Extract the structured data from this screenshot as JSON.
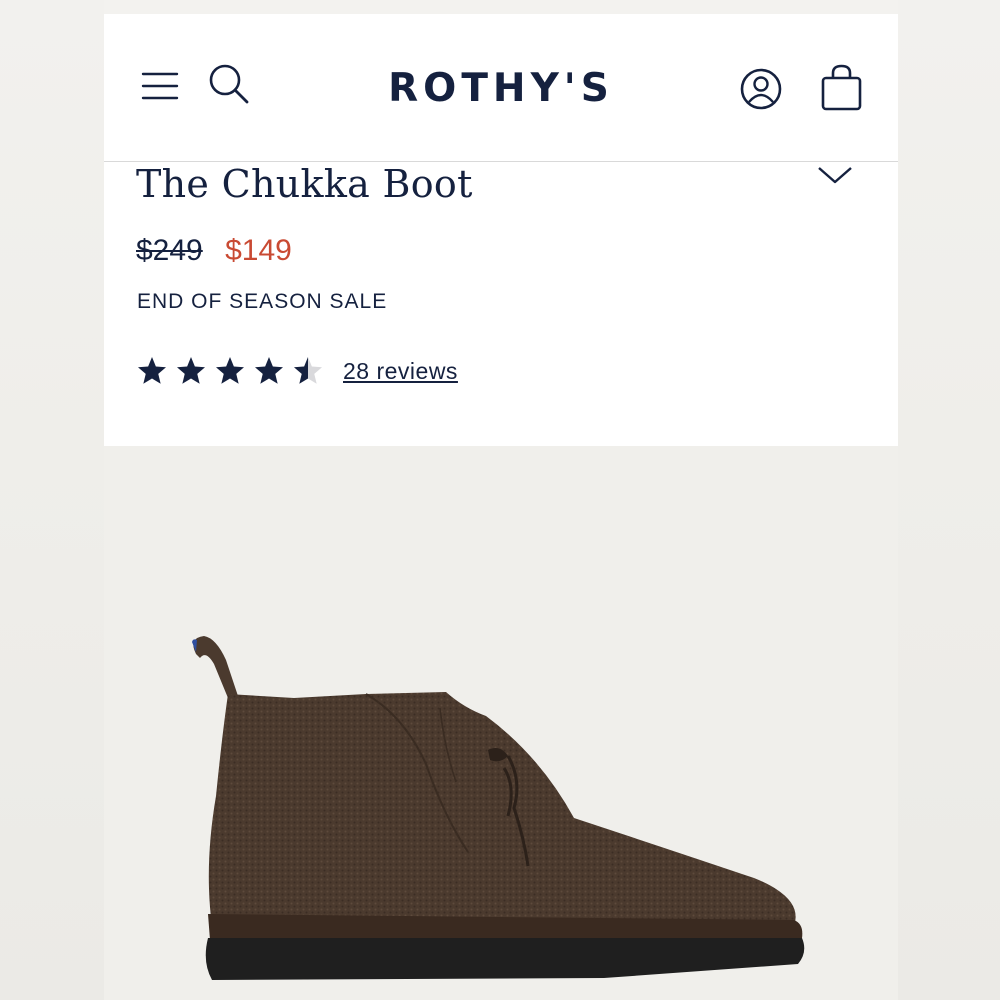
{
  "header": {
    "brand": "ROTHY'S",
    "icons": [
      "menu-icon",
      "search-icon",
      "account-icon",
      "shopping-bag-icon"
    ]
  },
  "product": {
    "title": "The Chukka Boot",
    "original_price": "$249",
    "sale_price": "$149",
    "promo_label": "END OF SEASON SALE",
    "rating": 4.5,
    "rating_max": 5,
    "reviews_label": "28 reviews",
    "image": "brown-knit-chukka-boot"
  },
  "colors": {
    "navy": "#15213f",
    "sale_red": "#c94a33",
    "background": "#f0efeb",
    "boot_brown": "#4b3a2e",
    "sole_black": "#1f1f1f"
  }
}
